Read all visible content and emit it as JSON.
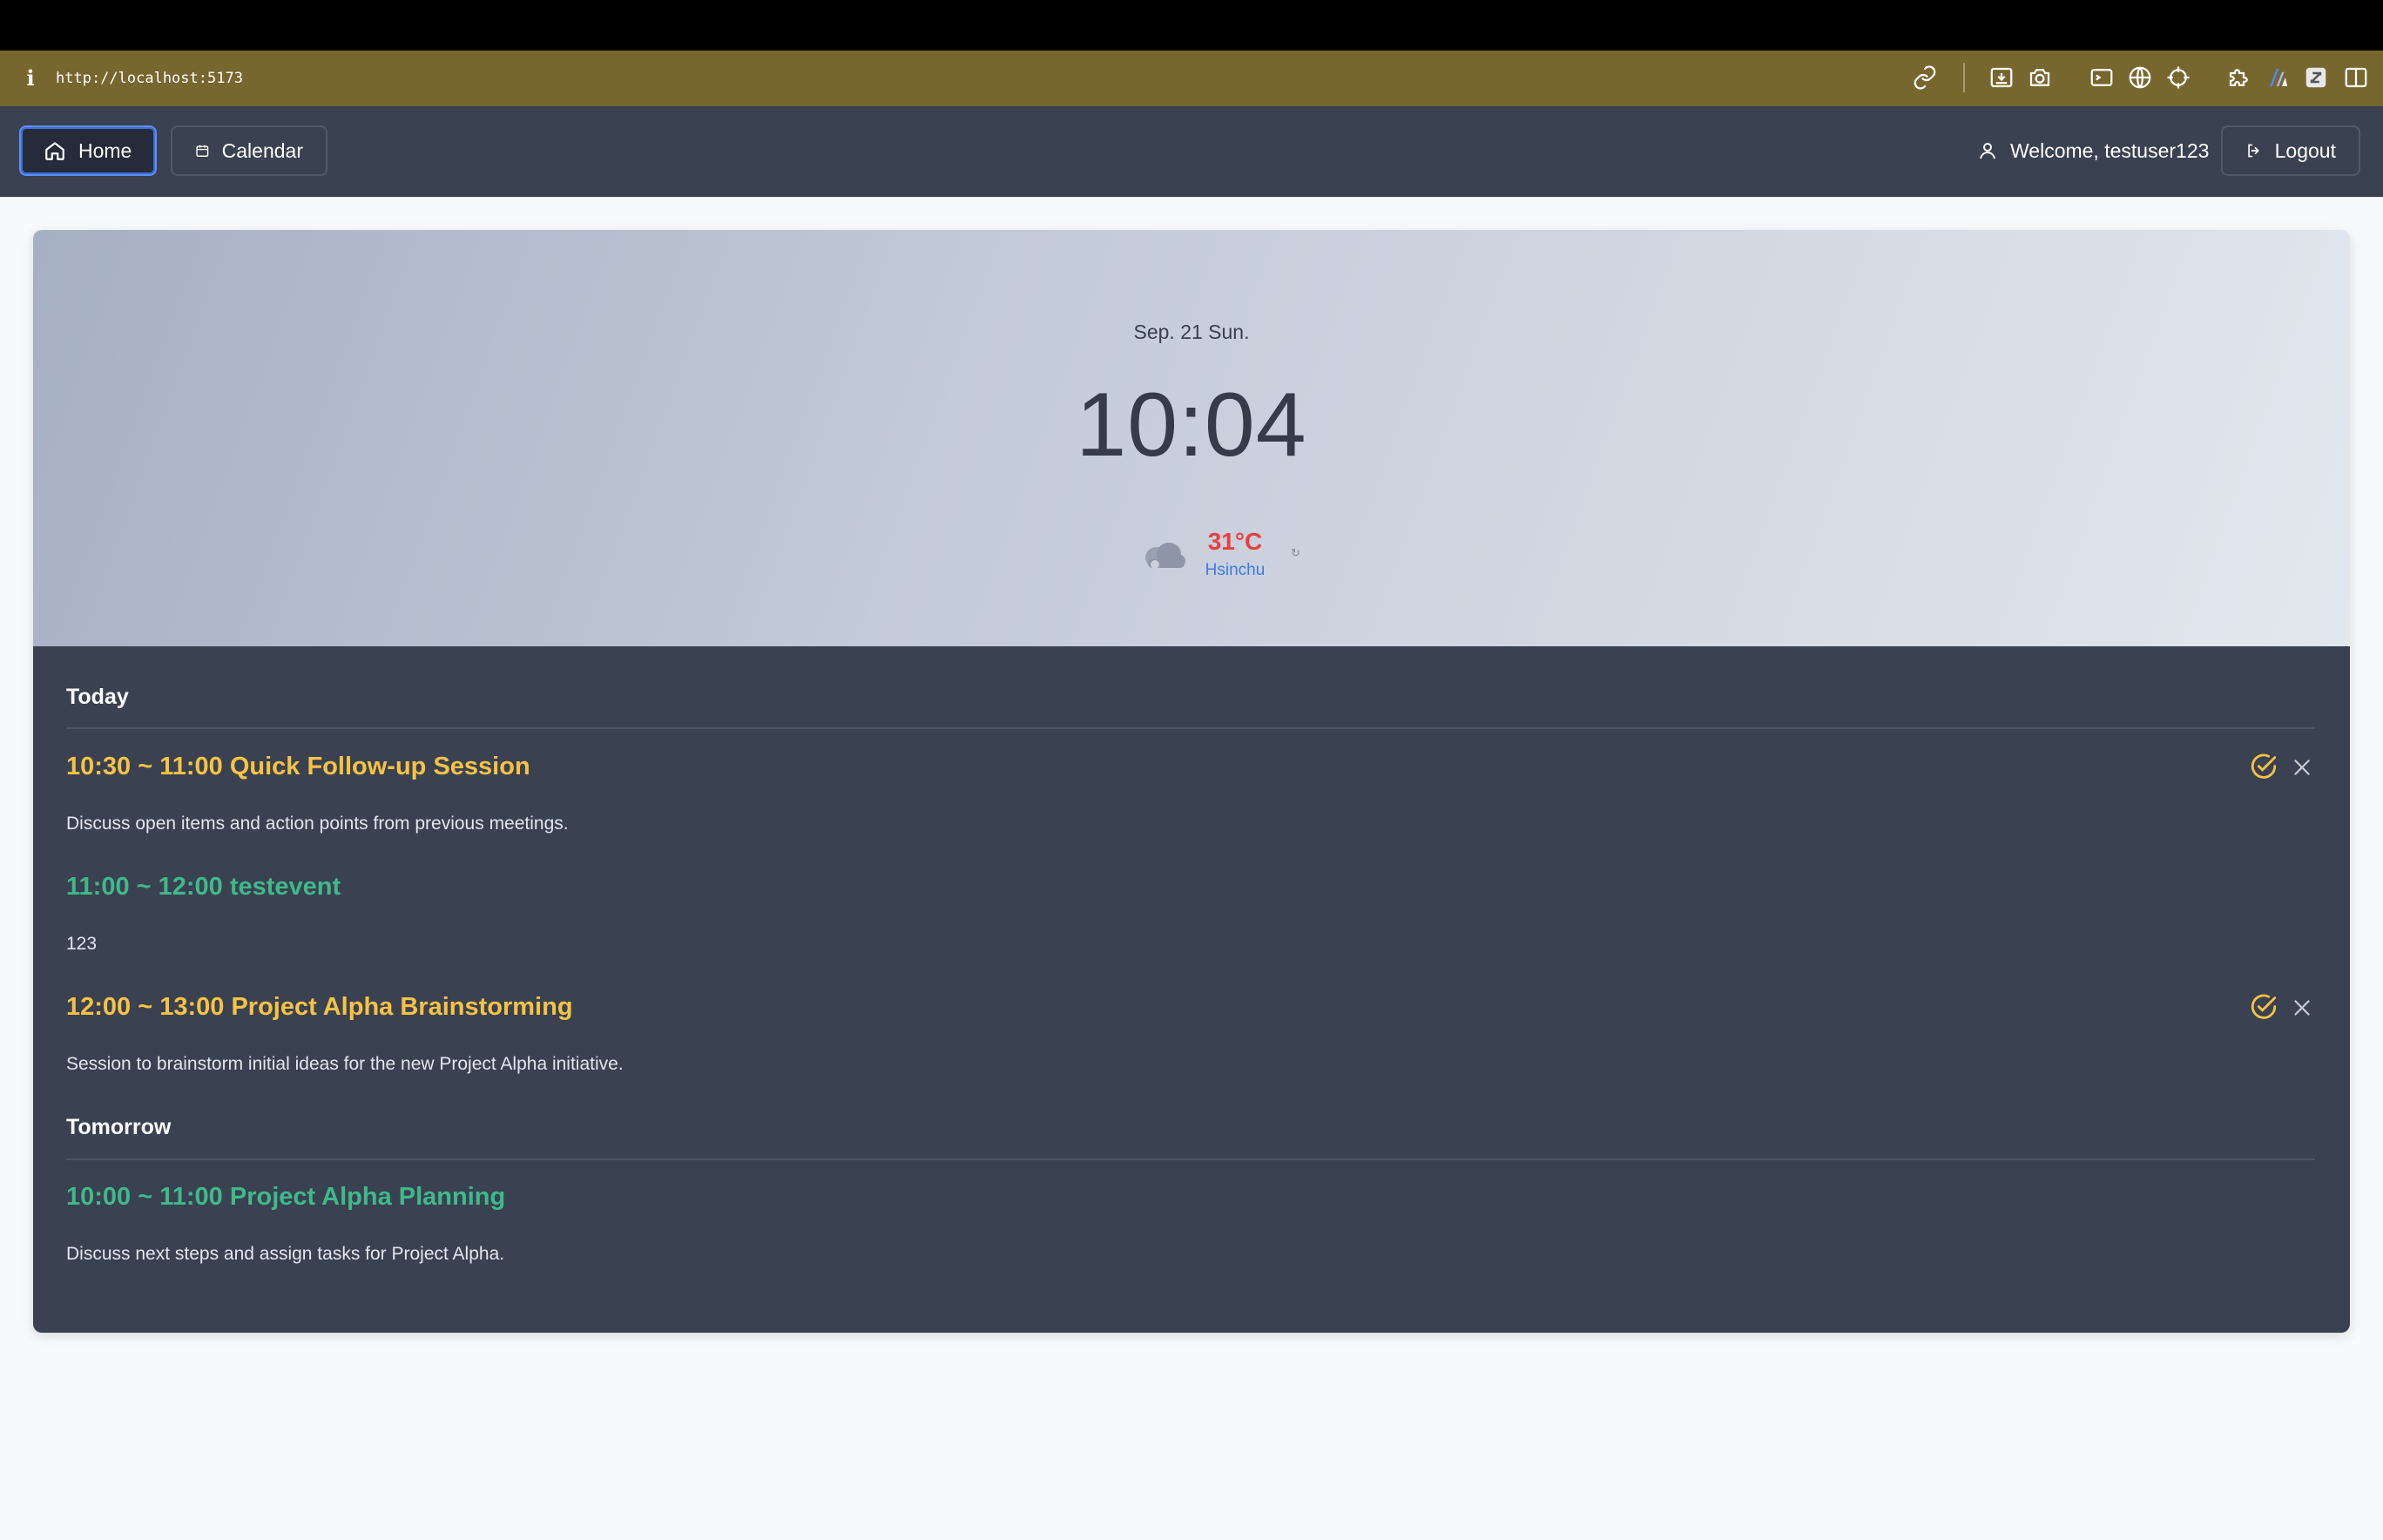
{
  "browser": {
    "url": "http://localhost:5173",
    "info_icon": "i",
    "toolbar_icons": [
      "link-icon",
      "download-box-icon",
      "camera-icon",
      "terminal-icon",
      "globe-icon",
      "crosshair-icon",
      "extensions-icon",
      "a-logo-icon",
      "z-logo-icon",
      "sidebar-toggle-icon"
    ]
  },
  "nav": {
    "home_label": "Home",
    "calendar_label": "Calendar",
    "welcome_text": "Welcome, testuser123",
    "logout_label": "Logout"
  },
  "hero": {
    "date": "Sep. 21 Sun.",
    "time": "10:04",
    "weather": {
      "temperature": "31°C",
      "city": "Hsinchu",
      "icon": "cloud-icon",
      "refresh_glyph": "↻"
    }
  },
  "schedule": {
    "today_label": "Today",
    "tomorrow_label": "Tomorrow",
    "today_events": [
      {
        "title": "10:30 ~ 11:00 Quick Follow-up Session",
        "description": "Discuss open items and action points from previous meetings.",
        "color": "#f5c344"
      },
      {
        "title": "11:00 ~ 12:00 testevent",
        "description": "123",
        "color": "#3fb989"
      },
      {
        "title": "12:00 ~ 13:00 Project Alpha Brainstorming",
        "description": "Session to brainstorm initial ideas for the new Project Alpha initiative.",
        "color": "#f5c344"
      }
    ],
    "tomorrow_events": [
      {
        "title": "10:00 ~ 11:00 Project Alpha Planning",
        "description": "Discuss next steps and assign tasks for Project Alpha.",
        "color": "#3fb989"
      }
    ]
  },
  "colors": {
    "navbar": "#3a4150",
    "schedule_bg": "#3a4151",
    "accent_yellow": "#f5c344",
    "accent_green": "#3fb989",
    "temp_red": "#e8403f",
    "city_blue": "#3d7be6",
    "browser_bar": "#78662f"
  }
}
